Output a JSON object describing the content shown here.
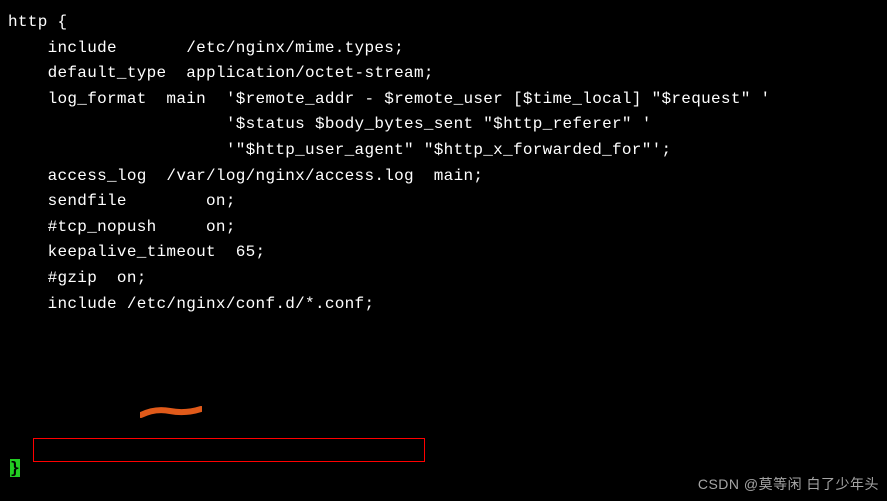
{
  "terminal": {
    "lines": [
      "http {",
      "    include       /etc/nginx/mime.types;",
      "    default_type  application/octet-stream;",
      "",
      "    log_format  main  '$remote_addr - $remote_user [$time_local] \"$request\" '",
      "                      '$status $body_bytes_sent \"$http_referer\" '",
      "                      '\"$http_user_agent\" \"$http_x_forwarded_for\"';",
      "",
      "    access_log  /var/log/nginx/access.log  main;",
      "",
      "    sendfile        on;",
      "    #tcp_nopush     on;",
      "",
      "    keepalive_timeout  65;",
      "",
      "    #gzip  on;",
      "",
      "    include /etc/nginx/conf.d/*.conf;"
    ]
  },
  "cursor": {
    "char": "}"
  },
  "watermark": {
    "text": "CSDN @莫等闲 白了少年头"
  }
}
